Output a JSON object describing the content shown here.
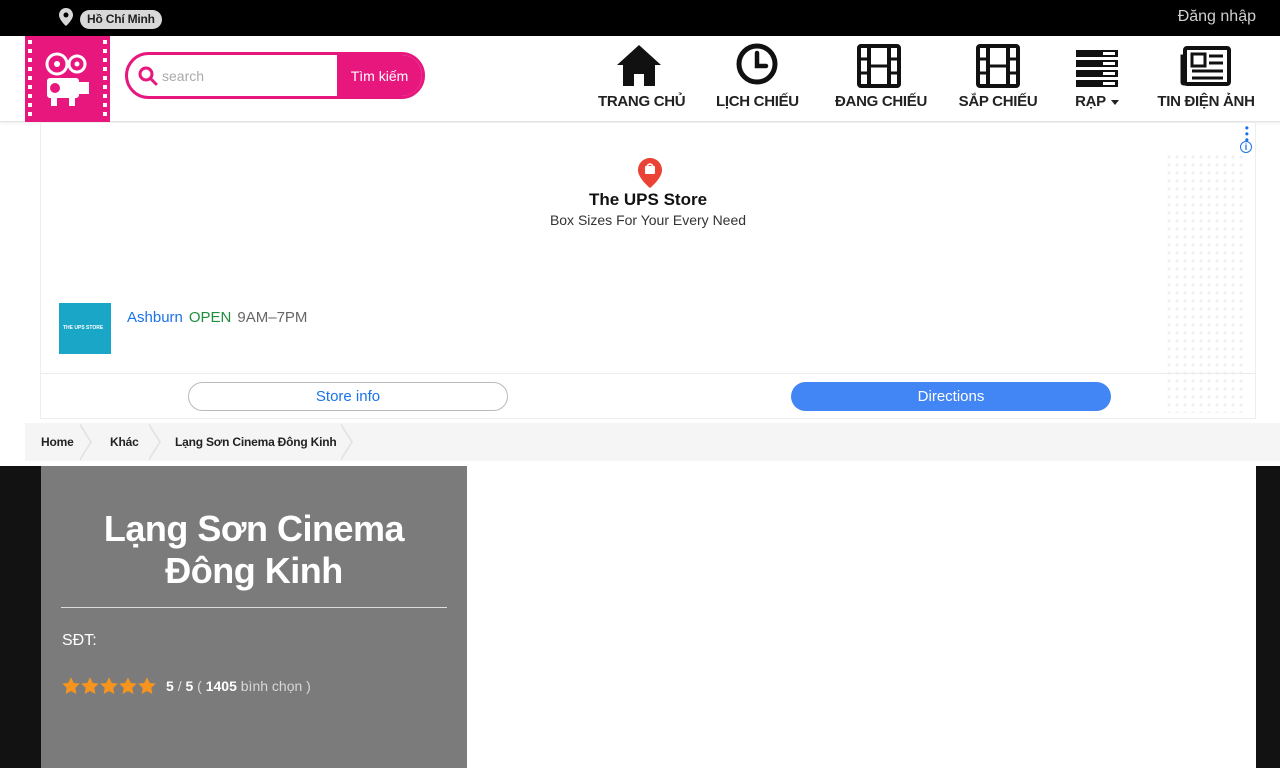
{
  "topbar": {
    "city": "Hồ Chí Minh",
    "login_label": "Đăng nhập"
  },
  "search": {
    "placeholder": "search",
    "button_label": "Tìm kiếm"
  },
  "nav": {
    "items": [
      {
        "label": "TRANG CHỦ",
        "icon": "home-icon"
      },
      {
        "label": "LỊCH CHIẾU",
        "icon": "clock-icon"
      },
      {
        "label": "ĐANG CHIẾU",
        "icon": "film-icon"
      },
      {
        "label": "SẮP CHIẾU",
        "icon": "film-icon"
      },
      {
        "label": "RẠP",
        "icon": "server-icon",
        "has_dropdown": true
      },
      {
        "label": "TIN ĐIỆN ẢNH",
        "icon": "newspaper-icon"
      }
    ]
  },
  "ad": {
    "title": "The UPS Store",
    "subtitle": "Box Sizes For Your Every Need",
    "thumb_text": "THE UPS STORE",
    "city": "Ashburn",
    "status": "OPEN",
    "hours": "9AM–7PM",
    "store_info_label": "Store info",
    "directions_label": "Directions",
    "info_icon": "i"
  },
  "breadcrumb": {
    "items": [
      "Home",
      "Khác",
      "Lạng Sơn Cinema Đông Kinh"
    ]
  },
  "cinema": {
    "name": "Lạng Sơn Cinema Đông Kinh",
    "phone_label": "SĐT:",
    "rating_stars": 5,
    "rating_value": "5",
    "rating_max": "5",
    "votes": "1405",
    "votes_label": "bình chọn"
  },
  "colors": {
    "brand": "#e7177e",
    "star": "#f7941d",
    "panel": "#7b7b7b"
  }
}
